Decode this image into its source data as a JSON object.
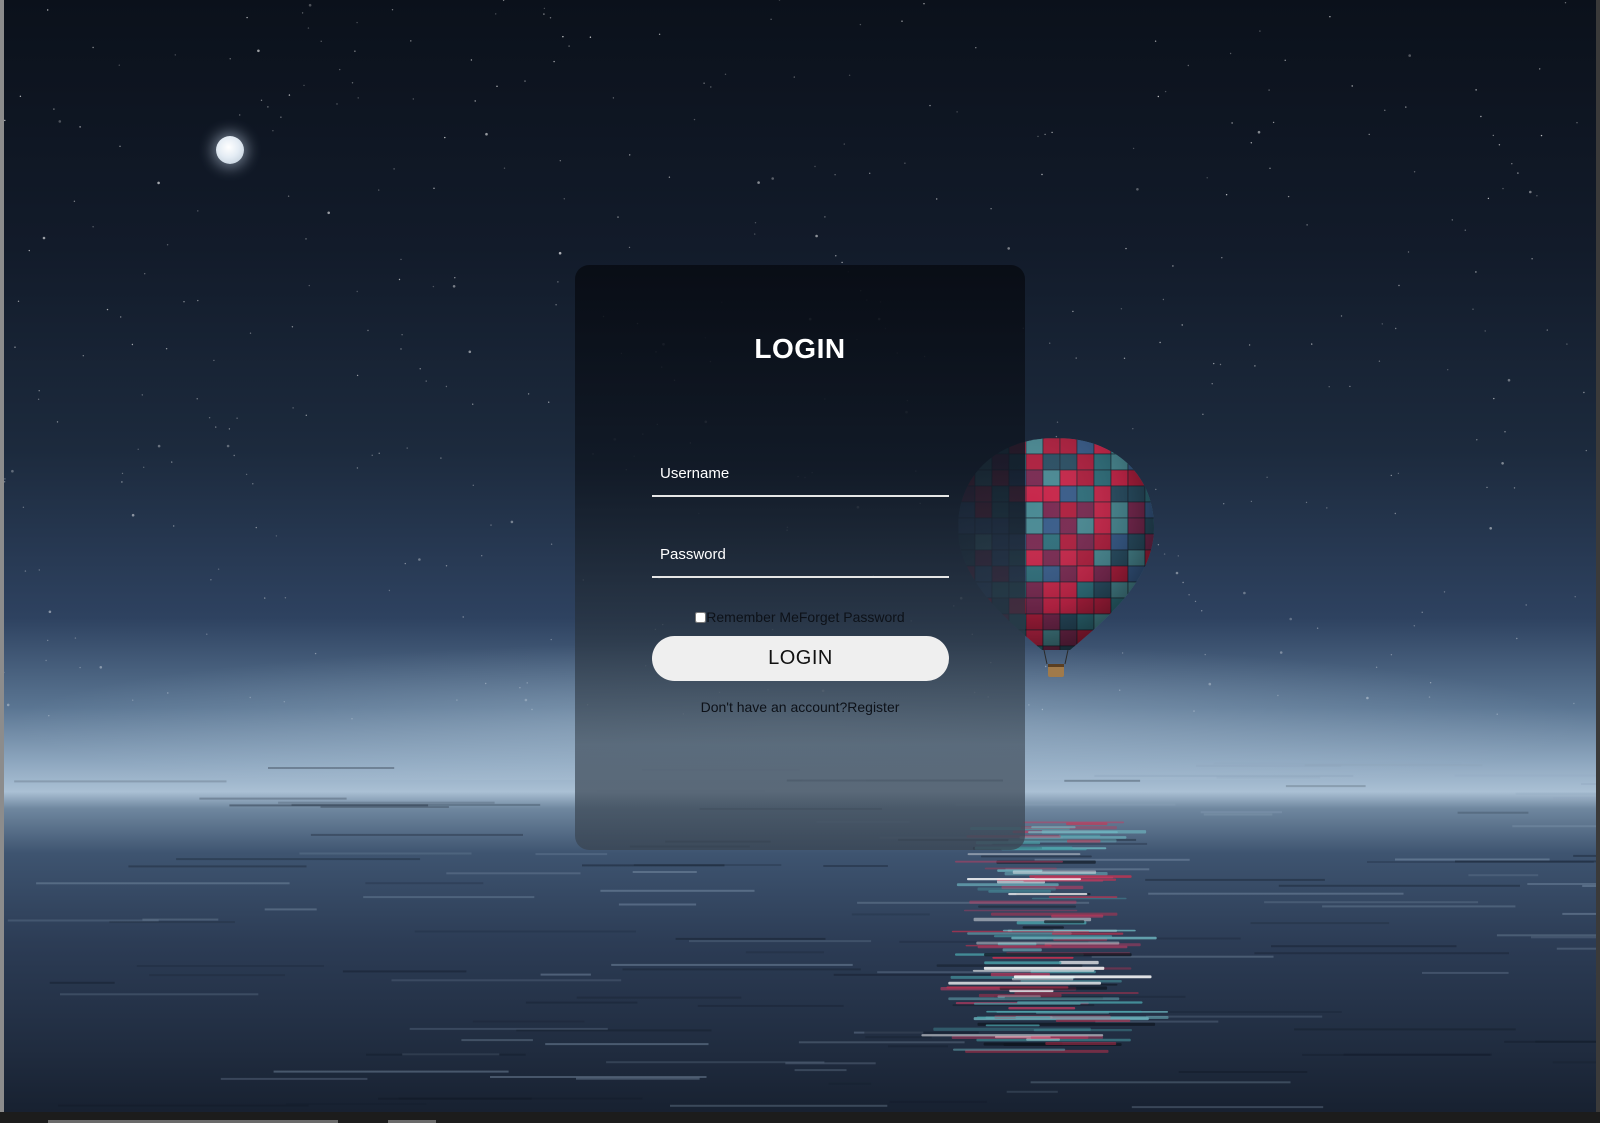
{
  "login_form": {
    "title": "LOGIN",
    "username_placeholder": "Username",
    "password_placeholder": "Password",
    "remember_label": "Remember Me",
    "forgot_label": "Forget Password",
    "submit_label": "LOGIN",
    "register_prompt": "Don't have an account?",
    "register_link": "Register"
  },
  "colors": {
    "button_bg": "#efefef",
    "title_text": "#ffffff",
    "card_bg_top": "#0a0f18",
    "sky_top": "#0b111b",
    "horizon_glow": "#aac0d4"
  }
}
